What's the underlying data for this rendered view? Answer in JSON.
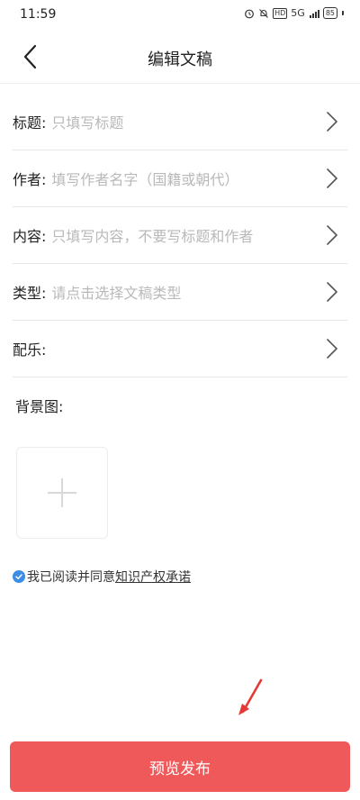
{
  "status_bar": {
    "time": "11:59",
    "hd_badge": "HD",
    "network": "5G",
    "battery": "85"
  },
  "header": {
    "title": "编辑文稿",
    "back_icon": "chevron-left-icon"
  },
  "form": {
    "title": {
      "label": "标题:",
      "placeholder": "只填写标题"
    },
    "author": {
      "label": "作者:",
      "placeholder": "填写作者名字（国籍或朝代）"
    },
    "content": {
      "label": "内容:",
      "placeholder": "只填写内容，不要写标题和作者"
    },
    "type": {
      "label": "类型:",
      "placeholder": "请点击选择文稿类型"
    },
    "music": {
      "label": "配乐:",
      "placeholder": ""
    }
  },
  "background": {
    "label": "背景图:",
    "add_icon": "plus-icon"
  },
  "agreement": {
    "text": "我已阅读并同意",
    "link": "知识产权承诺",
    "checked": true
  },
  "footer": {
    "publish_label": "预览发布"
  },
  "colors": {
    "accent": "#f0595a",
    "check": "#3b8de6",
    "annotation_arrow": "#e53935"
  }
}
